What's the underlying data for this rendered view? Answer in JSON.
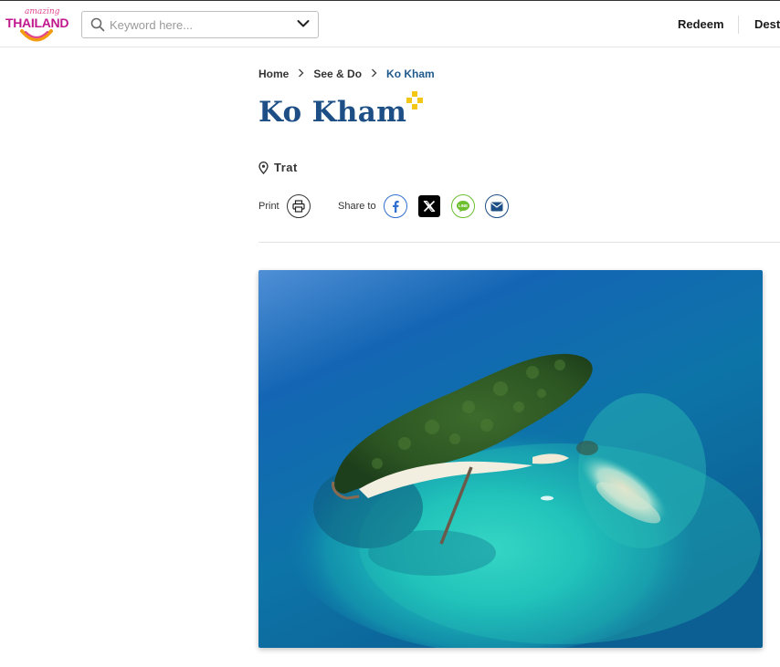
{
  "header": {
    "logo_small": "amazing",
    "logo_big": "THAILAND",
    "search_placeholder": "Keyword here...",
    "nav": {
      "redeem": "Redeem",
      "dest": "Dest"
    }
  },
  "breadcrumb": {
    "items": [
      "Home",
      "See & Do"
    ],
    "current": "Ko Kham",
    "separator": ">"
  },
  "page": {
    "title": "Ko Kham",
    "location": "Trat"
  },
  "actions": {
    "print_label": "Print",
    "share_label": "Share to"
  },
  "icons": {
    "search": "search-icon",
    "dropdown": "chevron-down-icon",
    "location": "map-pin-icon",
    "print": "printer-icon",
    "facebook": "facebook-icon",
    "x": "x-twitter-icon",
    "line": "line-icon",
    "email": "mail-icon",
    "sparkle": "sparkle-icon"
  },
  "colors": {
    "brand_magenta": "#c2188d",
    "title_blue": "#1d4f86",
    "breadcrumb_current": "#1f5a8c",
    "sparkle_yellow": "#f2c718",
    "facebook_blue": "#2f6fd1",
    "line_green": "#6cbf2f"
  }
}
